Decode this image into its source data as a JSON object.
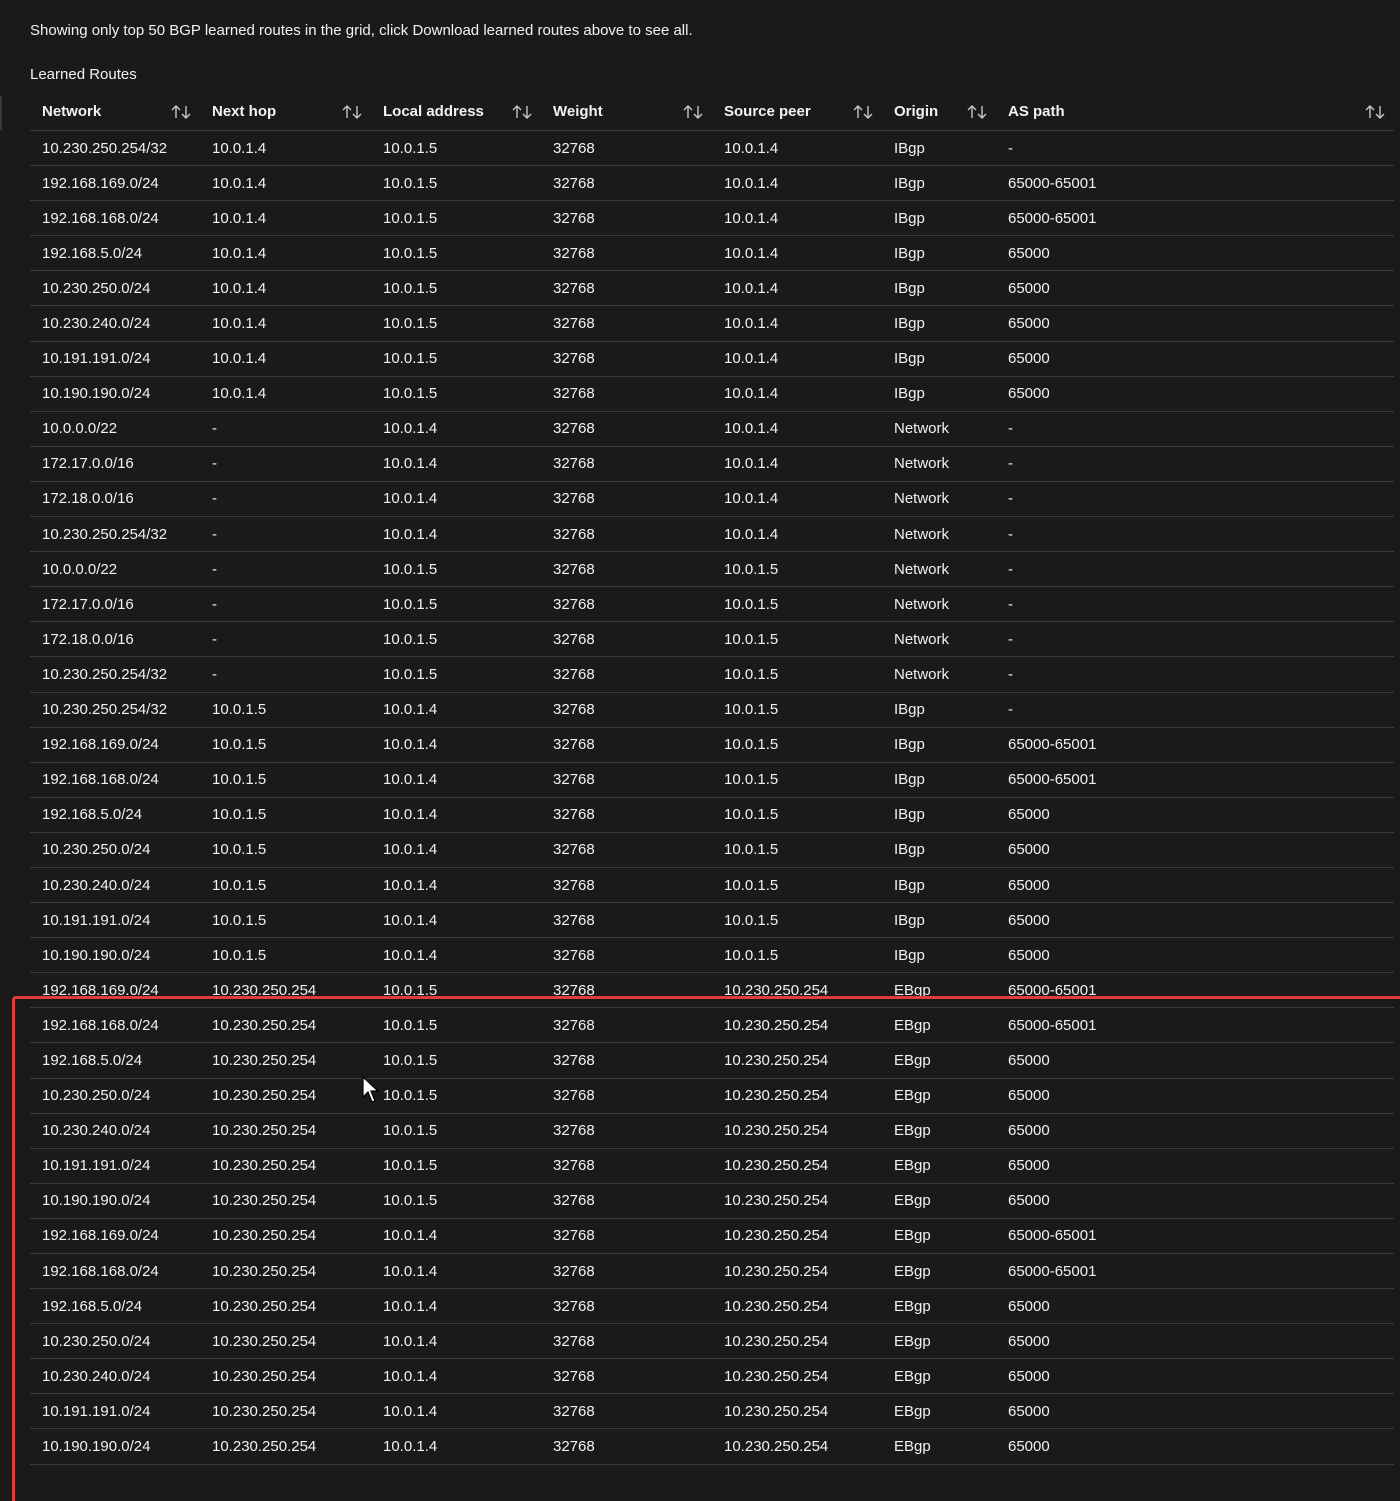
{
  "notice": "Showing only top 50 BGP learned routes in the grid, click Download learned routes above to see all.",
  "section_title": "Learned Routes",
  "columns": {
    "network": "Network",
    "next_hop": "Next hop",
    "local_address": "Local address",
    "weight": "Weight",
    "source_peer": "Source peer",
    "origin": "Origin",
    "as_path": "AS path"
  },
  "icons": {
    "sort": "sort-arrows-icon",
    "cursor": "mouse-pointer-icon"
  },
  "colors": {
    "background": "#1b1a19",
    "highlight": "#e03c3c"
  },
  "rows": [
    [
      "10.230.250.254/32",
      "10.0.1.4",
      "10.0.1.5",
      "32768",
      "10.0.1.4",
      "IBgp",
      "-"
    ],
    [
      "192.168.169.0/24",
      "10.0.1.4",
      "10.0.1.5",
      "32768",
      "10.0.1.4",
      "IBgp",
      "65000-65001"
    ],
    [
      "192.168.168.0/24",
      "10.0.1.4",
      "10.0.1.5",
      "32768",
      "10.0.1.4",
      "IBgp",
      "65000-65001"
    ],
    [
      "192.168.5.0/24",
      "10.0.1.4",
      "10.0.1.5",
      "32768",
      "10.0.1.4",
      "IBgp",
      "65000"
    ],
    [
      "10.230.250.0/24",
      "10.0.1.4",
      "10.0.1.5",
      "32768",
      "10.0.1.4",
      "IBgp",
      "65000"
    ],
    [
      "10.230.240.0/24",
      "10.0.1.4",
      "10.0.1.5",
      "32768",
      "10.0.1.4",
      "IBgp",
      "65000"
    ],
    [
      "10.191.191.0/24",
      "10.0.1.4",
      "10.0.1.5",
      "32768",
      "10.0.1.4",
      "IBgp",
      "65000"
    ],
    [
      "10.190.190.0/24",
      "10.0.1.4",
      "10.0.1.5",
      "32768",
      "10.0.1.4",
      "IBgp",
      "65000"
    ],
    [
      "10.0.0.0/22",
      "-",
      "10.0.1.4",
      "32768",
      "10.0.1.4",
      "Network",
      "-"
    ],
    [
      "172.17.0.0/16",
      "-",
      "10.0.1.4",
      "32768",
      "10.0.1.4",
      "Network",
      "-"
    ],
    [
      "172.18.0.0/16",
      "-",
      "10.0.1.4",
      "32768",
      "10.0.1.4",
      "Network",
      "-"
    ],
    [
      "10.230.250.254/32",
      "-",
      "10.0.1.4",
      "32768",
      "10.0.1.4",
      "Network",
      "-"
    ],
    [
      "10.0.0.0/22",
      "-",
      "10.0.1.5",
      "32768",
      "10.0.1.5",
      "Network",
      "-"
    ],
    [
      "172.17.0.0/16",
      "-",
      "10.0.1.5",
      "32768",
      "10.0.1.5",
      "Network",
      "-"
    ],
    [
      "172.18.0.0/16",
      "-",
      "10.0.1.5",
      "32768",
      "10.0.1.5",
      "Network",
      "-"
    ],
    [
      "10.230.250.254/32",
      "-",
      "10.0.1.5",
      "32768",
      "10.0.1.5",
      "Network",
      "-"
    ],
    [
      "10.230.250.254/32",
      "10.0.1.5",
      "10.0.1.4",
      "32768",
      "10.0.1.5",
      "IBgp",
      "-"
    ],
    [
      "192.168.169.0/24",
      "10.0.1.5",
      "10.0.1.4",
      "32768",
      "10.0.1.5",
      "IBgp",
      "65000-65001"
    ],
    [
      "192.168.168.0/24",
      "10.0.1.5",
      "10.0.1.4",
      "32768",
      "10.0.1.5",
      "IBgp",
      "65000-65001"
    ],
    [
      "192.168.5.0/24",
      "10.0.1.5",
      "10.0.1.4",
      "32768",
      "10.0.1.5",
      "IBgp",
      "65000"
    ],
    [
      "10.230.250.0/24",
      "10.0.1.5",
      "10.0.1.4",
      "32768",
      "10.0.1.5",
      "IBgp",
      "65000"
    ],
    [
      "10.230.240.0/24",
      "10.0.1.5",
      "10.0.1.4",
      "32768",
      "10.0.1.5",
      "IBgp",
      "65000"
    ],
    [
      "10.191.191.0/24",
      "10.0.1.5",
      "10.0.1.4",
      "32768",
      "10.0.1.5",
      "IBgp",
      "65000"
    ],
    [
      "10.190.190.0/24",
      "10.0.1.5",
      "10.0.1.4",
      "32768",
      "10.0.1.5",
      "IBgp",
      "65000"
    ],
    [
      "192.168.169.0/24",
      "10.230.250.254",
      "10.0.1.5",
      "32768",
      "10.230.250.254",
      "EBgp",
      "65000-65001"
    ],
    [
      "192.168.168.0/24",
      "10.230.250.254",
      "10.0.1.5",
      "32768",
      "10.230.250.254",
      "EBgp",
      "65000-65001"
    ],
    [
      "192.168.5.0/24",
      "10.230.250.254",
      "10.0.1.5",
      "32768",
      "10.230.250.254",
      "EBgp",
      "65000"
    ],
    [
      "10.230.250.0/24",
      "10.230.250.254",
      "10.0.1.5",
      "32768",
      "10.230.250.254",
      "EBgp",
      "65000"
    ],
    [
      "10.230.240.0/24",
      "10.230.250.254",
      "10.0.1.5",
      "32768",
      "10.230.250.254",
      "EBgp",
      "65000"
    ],
    [
      "10.191.191.0/24",
      "10.230.250.254",
      "10.0.1.5",
      "32768",
      "10.230.250.254",
      "EBgp",
      "65000"
    ],
    [
      "10.190.190.0/24",
      "10.230.250.254",
      "10.0.1.5",
      "32768",
      "10.230.250.254",
      "EBgp",
      "65000"
    ],
    [
      "192.168.169.0/24",
      "10.230.250.254",
      "10.0.1.4",
      "32768",
      "10.230.250.254",
      "EBgp",
      "65000-65001"
    ],
    [
      "192.168.168.0/24",
      "10.230.250.254",
      "10.0.1.4",
      "32768",
      "10.230.250.254",
      "EBgp",
      "65000-65001"
    ],
    [
      "192.168.5.0/24",
      "10.230.250.254",
      "10.0.1.4",
      "32768",
      "10.230.250.254",
      "EBgp",
      "65000"
    ],
    [
      "10.230.250.0/24",
      "10.230.250.254",
      "10.0.1.4",
      "32768",
      "10.230.250.254",
      "EBgp",
      "65000"
    ],
    [
      "10.230.240.0/24",
      "10.230.250.254",
      "10.0.1.4",
      "32768",
      "10.230.250.254",
      "EBgp",
      "65000"
    ],
    [
      "10.191.191.0/24",
      "10.230.250.254",
      "10.0.1.4",
      "32768",
      "10.230.250.254",
      "EBgp",
      "65000"
    ],
    [
      "10.190.190.0/24",
      "10.230.250.254",
      "10.0.1.4",
      "32768",
      "10.230.250.254",
      "EBgp",
      "65000"
    ]
  ]
}
